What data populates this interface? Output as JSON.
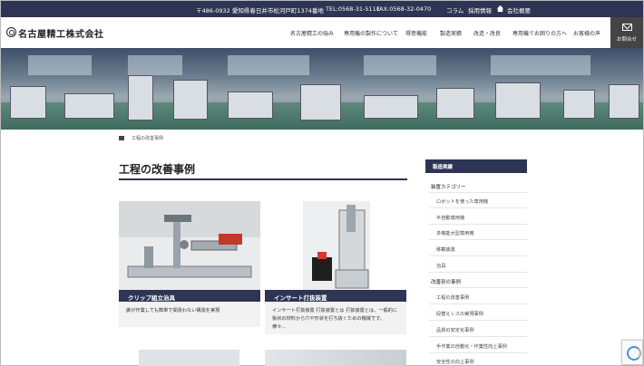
{
  "topbar": {
    "address": "〒486-0932 愛知県春日井市松河戸町1374番地",
    "tel": "TEL:0568-31-5111",
    "fax": "FAX:0568-32-0470",
    "column": "コラム",
    "recruit": "採用情報",
    "company": "会社概要"
  },
  "header": {
    "logo": "名古屋精工株式会社",
    "nav": [
      "名古屋精工の強み",
      "専用機の製作について",
      "得意機能",
      "製造実績",
      "改造・改良",
      "専用機でお困りの方へ",
      "お客様の声"
    ],
    "contact": "お問合せ"
  },
  "breadcrumb": {
    "current": "工程の改善事例"
  },
  "page_title": "工程の改善事例",
  "cards": [
    {
      "caption": "クリップ組立治具",
      "desc": "誰が作業しても簡単で間違わない構造を実現"
    },
    {
      "caption": "インサート打抜装置",
      "desc": "インサート打抜装置 打抜装置とは 打抜装置とは、一般的に板状の材料から穴や形状を打ち抜くための機械です。 様々…"
    }
  ],
  "sidebar": {
    "title": "製造実績",
    "cat1": "装置カテゴリー",
    "cat1_items": [
      "ロボットを使った専用機",
      "半自動専用機",
      "多機能大型専用機",
      "移載装置",
      "治具"
    ],
    "cat2": "改善別の事例",
    "cat2_items": [
      "工程の改善事例",
      "段替えレスの実現事例",
      "品質の安定化事例",
      "手作業の自動化・作業性向上事例",
      "安全性の向上事例"
    ]
  },
  "colors": {
    "navy": "#2d3454"
  }
}
